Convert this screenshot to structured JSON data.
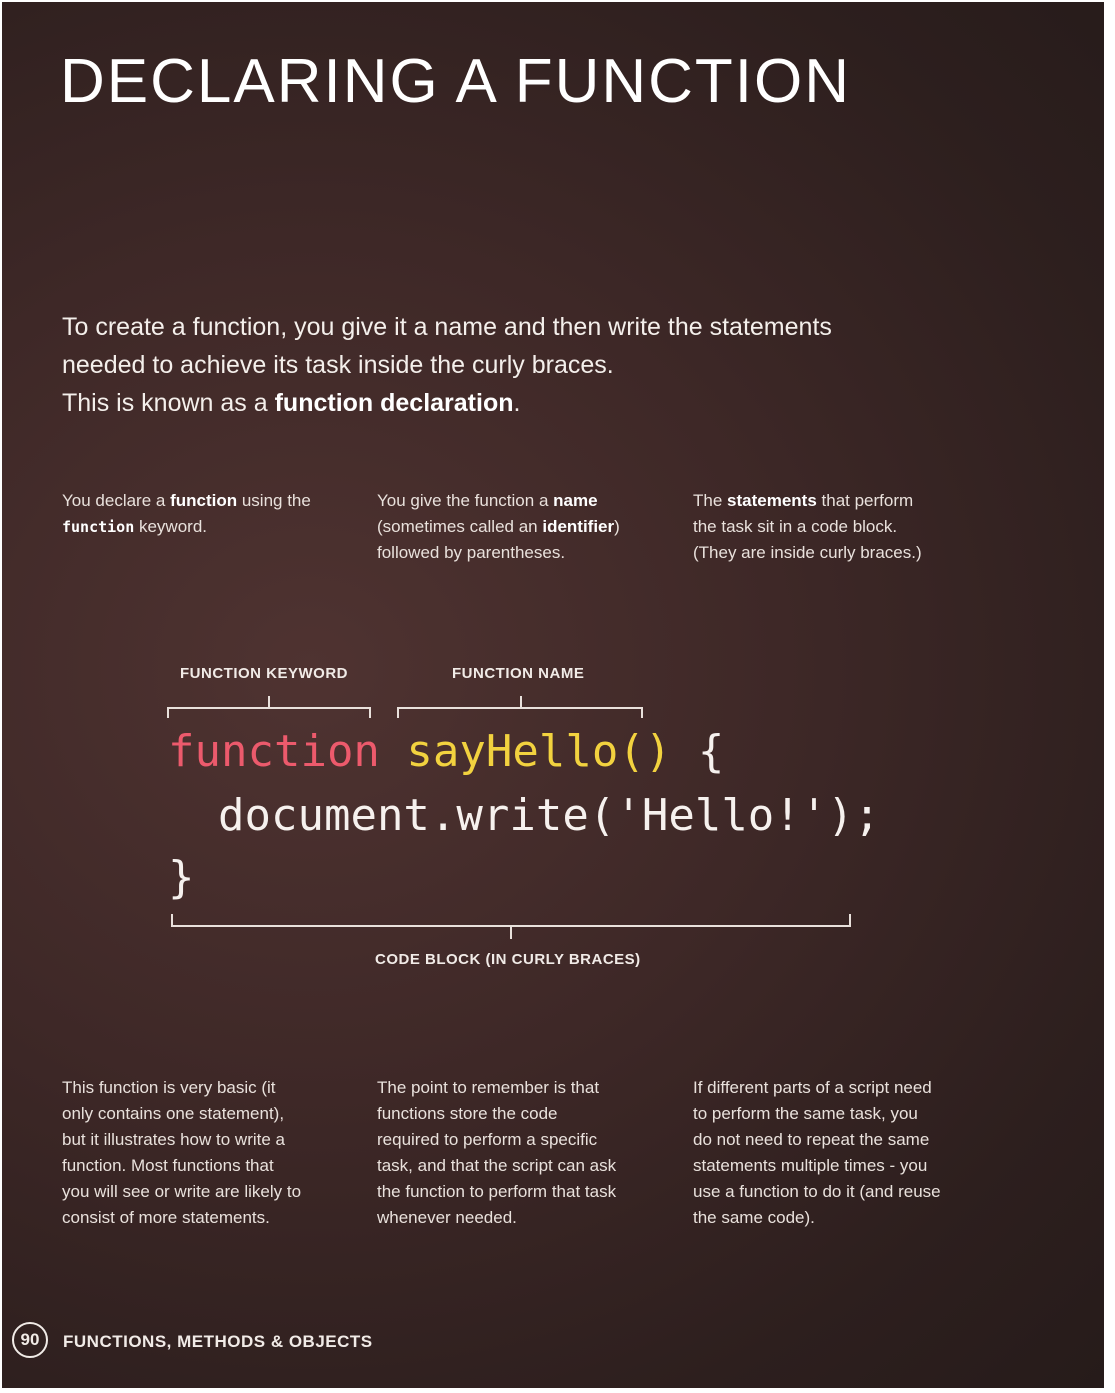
{
  "page": {
    "title": "DECLARING A FUNCTION",
    "intro": {
      "line1": "To create a function, you give it a name and then write the statements",
      "line2": "needed to achieve its task inside the curly braces.",
      "line3_prefix": "This is known as a ",
      "line3_bold": "function declaration",
      "line3_suffix": "."
    },
    "top_notes": [
      {
        "a": "You declare a ",
        "b": "function",
        "c": " using the",
        "d": "function",
        "e": " keyword."
      },
      {
        "a": "You give the function a ",
        "b": "name",
        "c": "(sometimes called an ",
        "d": "identifier",
        "e": ")",
        "f": "followed by parentheses."
      },
      {
        "a": "The ",
        "b": "statements",
        "c": " that perform",
        "d": "the task sit in a code block.",
        "e": "(They are inside curly braces.)"
      }
    ],
    "labels": {
      "function_keyword": "FUNCTION KEYWORD",
      "function_name": "FUNCTION NAME",
      "code_block": "CODE BLOCK (IN CURLY BRACES)"
    },
    "code": {
      "keyword": "function",
      "name": "sayHello()",
      "open_brace": " {",
      "body": "document.write('Hello!');",
      "close_brace": "}"
    },
    "bottom_notes": [
      "This function is very basic (it\nonly contains one statement),\nbut it illustrates how to write a\nfunction. Most functions that\nyou will see or write are likely to\nconsist of more statements.",
      "The point to remember is that\nfunctions store the code\nrequired to perform a specific\ntask, and that the script can ask\nthe function to perform that task\nwhenever needed.",
      "If different parts of a script need\nto perform the same task, you\ndo not need to repeat the same\nstatements multiple times - you\nuse a function to do it (and reuse\nthe same code)."
    ],
    "footer": {
      "page_number": "90",
      "section": "FUNCTIONS, METHODS & OBJECTS"
    }
  }
}
